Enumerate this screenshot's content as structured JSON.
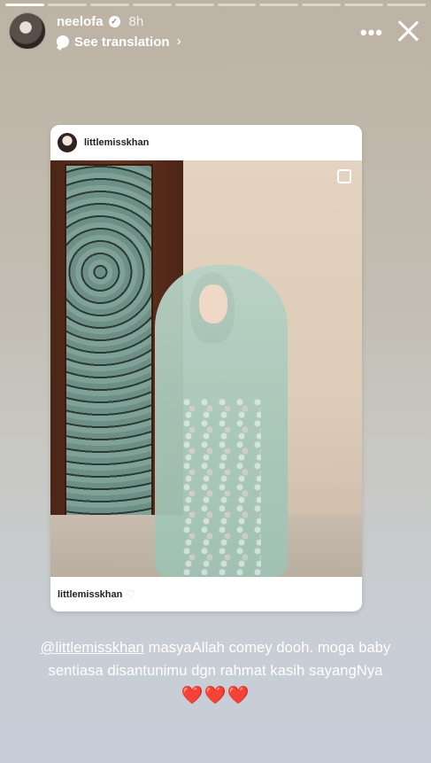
{
  "story": {
    "segments_total": 10,
    "segments_done": 1
  },
  "header": {
    "username": "neelofa",
    "verified_mark": "✓",
    "time": "8h",
    "translate_label": "See translation",
    "translate_chevron": "›",
    "more_label": "•••"
  },
  "card": {
    "username": "littlemisskhan",
    "footer_username": "littlemisskhan",
    "footer_heart": "♡"
  },
  "caption": {
    "mention": "@littlemisskhan",
    "text_1": " masyaAllah comey dooh. moga baby",
    "text_2": "sentiasa disantunimu dgn rahmat kasih sayangNya",
    "hearts": "❤️❤️❤️"
  },
  "icons": {
    "verified": "verified-badge-icon",
    "translate": "speech-bubble-icon",
    "more": "more-options-icon",
    "close": "close-icon",
    "collage": "multiple-photos-icon"
  }
}
